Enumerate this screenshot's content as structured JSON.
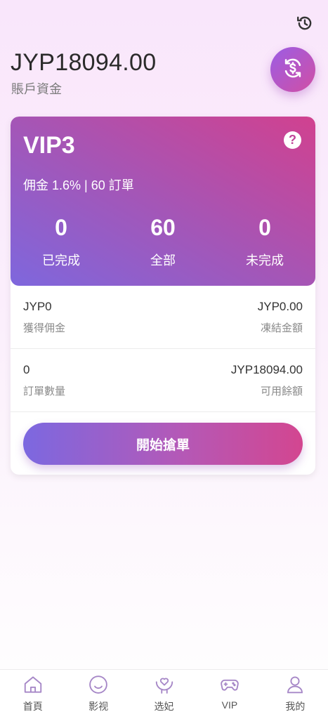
{
  "header": {
    "history_icon": "history-icon",
    "balance": "JYP18094.00",
    "balance_label": "賬戶資金",
    "exchange_icon": "currency-exchange-icon"
  },
  "vip_card": {
    "level": "VIP3",
    "help_icon": "help-icon",
    "help_symbol": "?",
    "commission_text": "佣金 1.6% | 60 訂單",
    "stats": [
      {
        "value": "0",
        "label": "已完成"
      },
      {
        "value": "60",
        "label": "全部"
      },
      {
        "value": "0",
        "label": "未完成"
      }
    ]
  },
  "info": {
    "earned_commission_value": "JYP0",
    "earned_commission_label": "獲得佣金",
    "frozen_amount_value": "JYP0.00",
    "frozen_amount_label": "凍結金額",
    "order_count_value": "0",
    "order_count_label": "訂單數量",
    "available_balance_value": "JYP18094.00",
    "available_balance_label": "可用餘額"
  },
  "start_button_label": "開始搶單",
  "tabbar": {
    "tabs": [
      {
        "label": "首頁",
        "icon": "home-icon"
      },
      {
        "label": "影视",
        "icon": "smile-icon"
      },
      {
        "label": "选妃",
        "icon": "heart-hand-icon"
      },
      {
        "label": "VIP",
        "icon": "gamepad-icon"
      },
      {
        "label": "我的",
        "icon": "user-icon"
      }
    ],
    "icon_color": "#a687c7"
  },
  "colors": {
    "accent_start": "#7e67dd",
    "accent_end": "#d1418f"
  }
}
